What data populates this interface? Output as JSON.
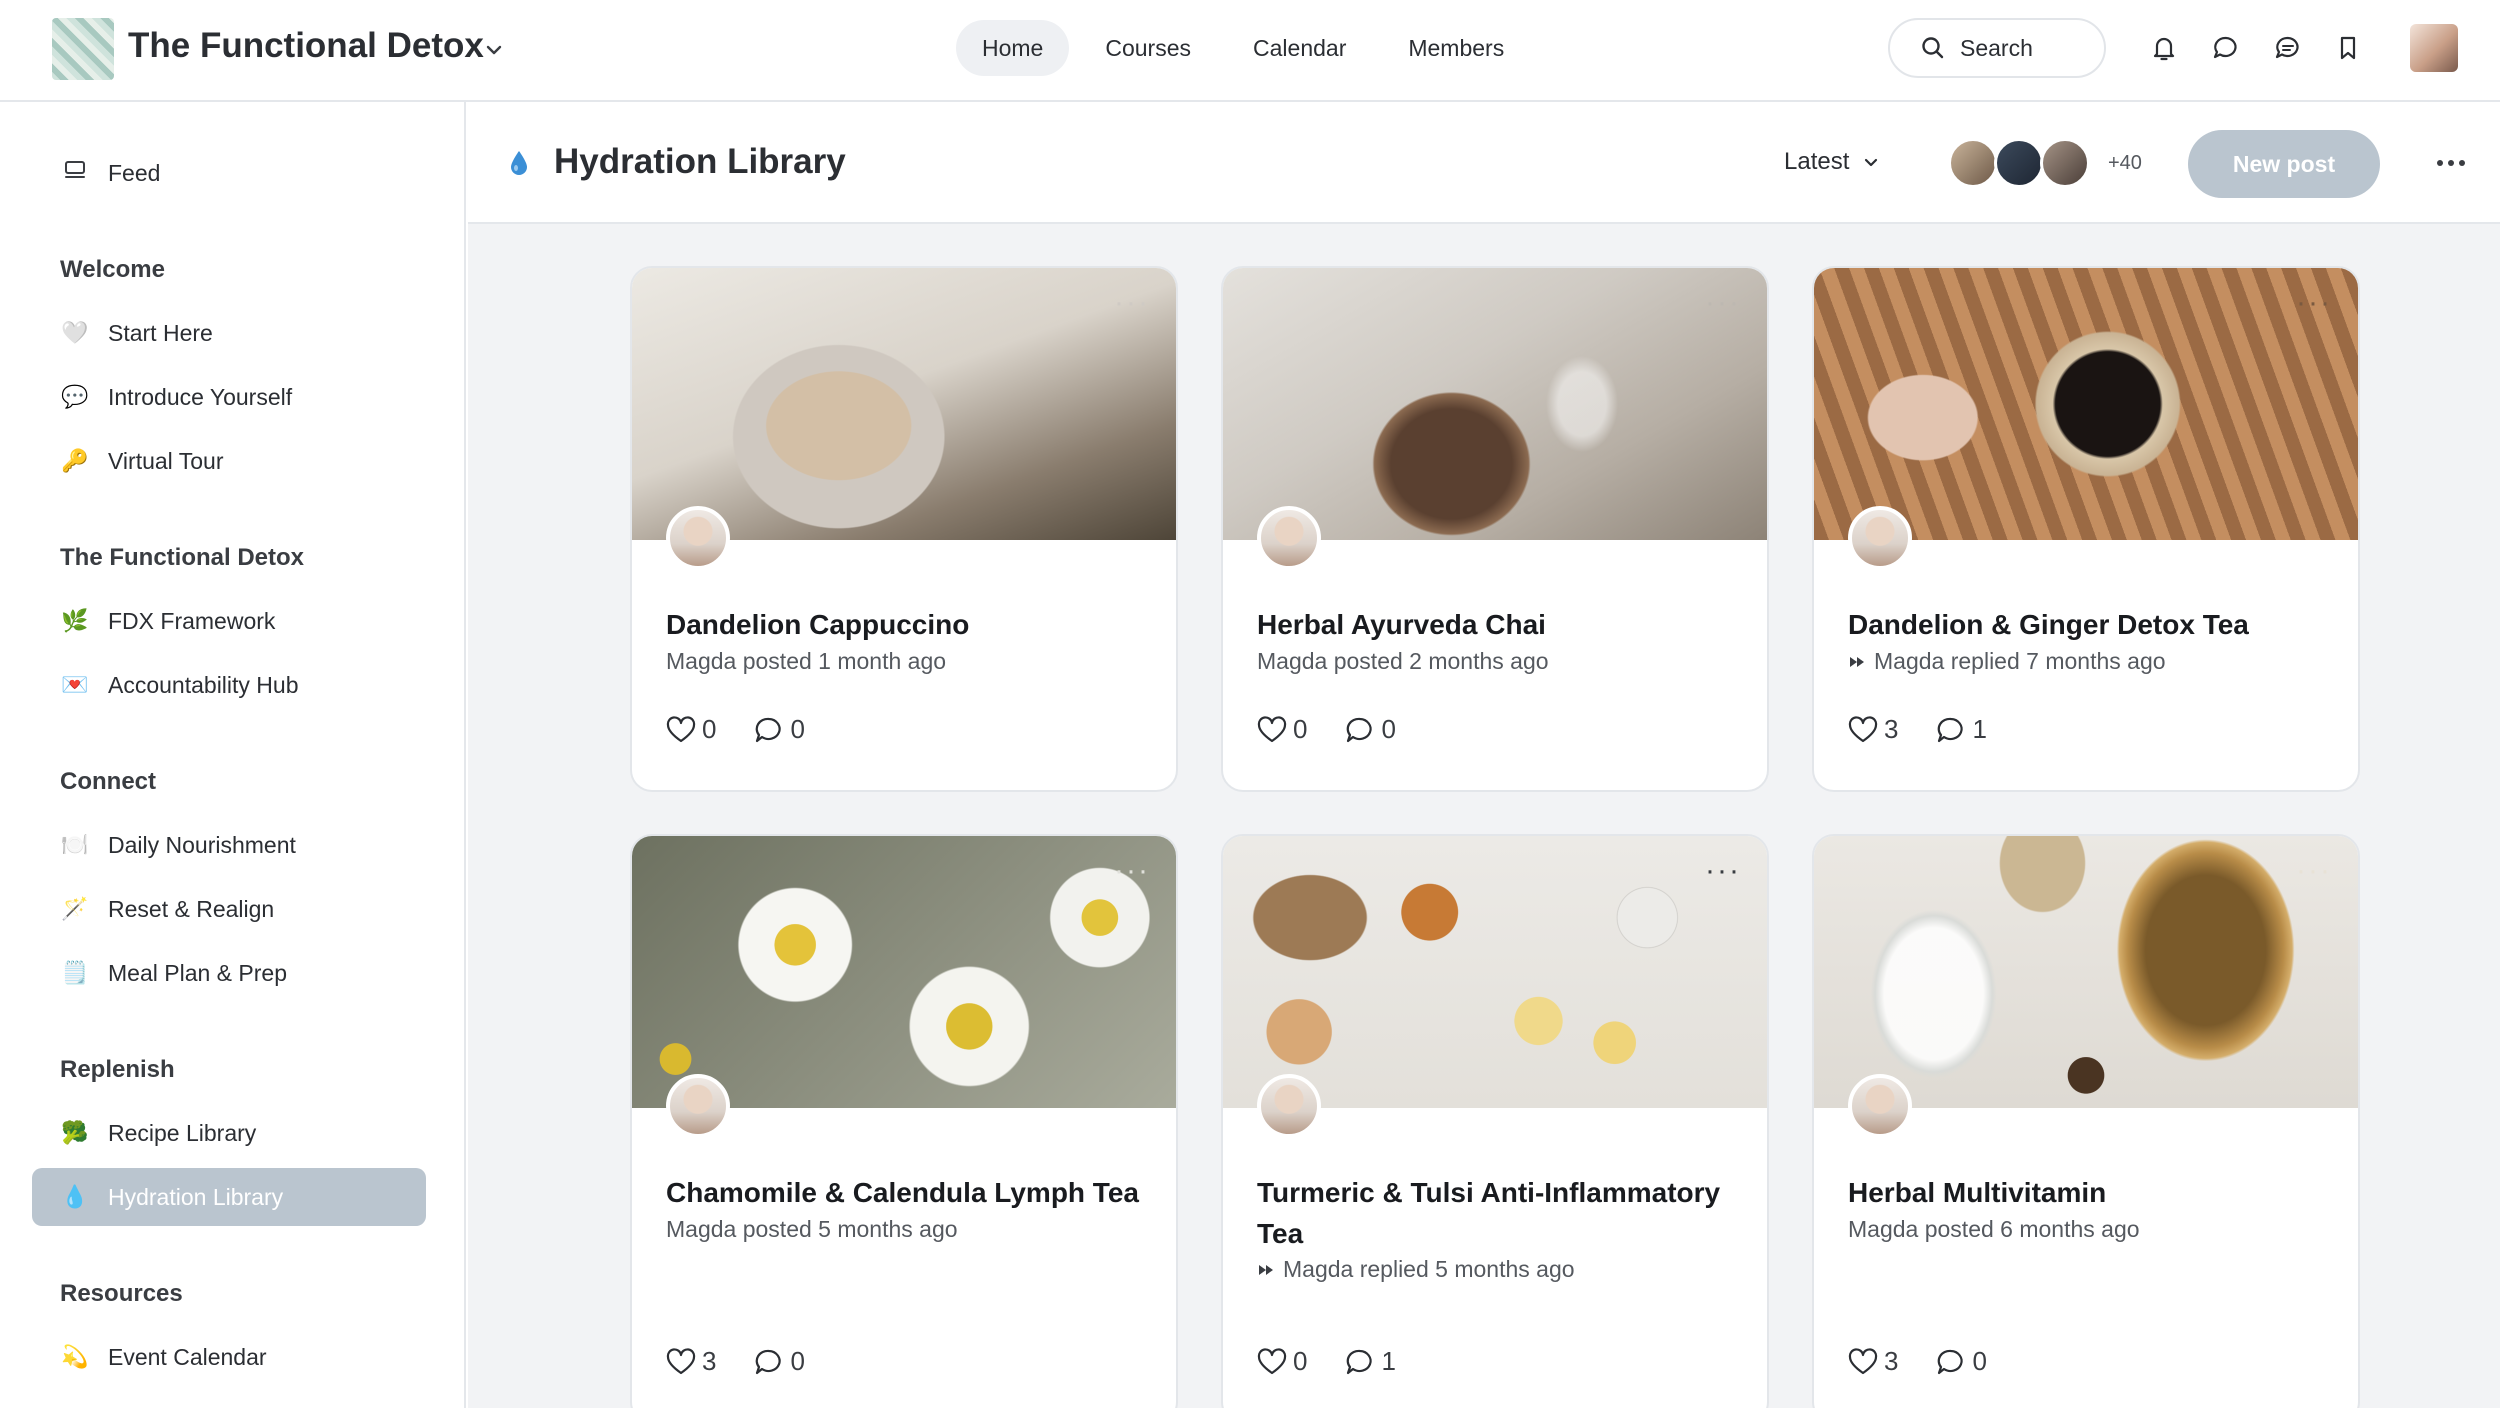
{
  "topbar": {
    "community_name": "The Functional Detox",
    "nav": [
      "Home",
      "Courses",
      "Calendar",
      "Members"
    ],
    "active_nav": "Home",
    "search_label": "Search",
    "icons": [
      "bell-icon",
      "chat-bubble-icon",
      "messages-icon",
      "bookmark-icon"
    ]
  },
  "sidebar": {
    "feed": {
      "emoji": "",
      "label": "Feed"
    },
    "sections": [
      {
        "heading": "Welcome",
        "items": [
          {
            "emoji": "🤍",
            "label": "Start Here"
          },
          {
            "emoji": "💬",
            "label": "Introduce Yourself"
          },
          {
            "emoji": "🔑",
            "label": "Virtual Tour"
          }
        ]
      },
      {
        "heading": "The Functional Detox",
        "items": [
          {
            "emoji": "🌿",
            "label": "FDX Framework"
          },
          {
            "emoji": "💌",
            "label": "Accountability Hub"
          }
        ]
      },
      {
        "heading": "Connect",
        "items": [
          {
            "emoji": "🍽️",
            "label": "Daily Nourishment"
          },
          {
            "emoji": "🪄",
            "label": "Reset & Realign"
          },
          {
            "emoji": "🗒️",
            "label": "Meal Plan & Prep"
          }
        ]
      },
      {
        "heading": "Replenish",
        "items": [
          {
            "emoji": "🥦",
            "label": "Recipe Library"
          },
          {
            "emoji": "💧",
            "label": "Hydration Library"
          }
        ]
      },
      {
        "heading": "Resources",
        "items": [
          {
            "emoji": "💫",
            "label": "Event Calendar"
          }
        ]
      }
    ],
    "active_item": "Hydration Library"
  },
  "main": {
    "title": "Hydration Library",
    "sort_label": "Latest",
    "members_more": "+40",
    "new_post_label": "New post"
  },
  "posts": [
    {
      "title": "Dandelion Cappuccino",
      "meta": "Magda posted 1 month ago",
      "replied": false,
      "likes": "0",
      "comments": "0"
    },
    {
      "title": "Herbal Ayurveda Chai",
      "meta": "Magda posted 2 months ago",
      "replied": false,
      "likes": "0",
      "comments": "0"
    },
    {
      "title": "Dandelion & Ginger Detox Tea",
      "meta": "Magda replied 7 months ago",
      "replied": true,
      "likes": "3",
      "comments": "1"
    },
    {
      "title": "Chamomile & Calendula Lymph Tea",
      "meta": "Magda posted 5 months ago",
      "replied": false,
      "likes": "3",
      "comments": "0"
    },
    {
      "title": "Turmeric & Tulsi Anti-Inflammatory Tea",
      "meta": "Magda replied 5 months ago",
      "replied": true,
      "likes": "0",
      "comments": "1"
    },
    {
      "title": "Herbal Multivitamin",
      "meta": "Magda posted 6 months ago",
      "replied": false,
      "likes": "3",
      "comments": "0"
    }
  ],
  "colors": {
    "active_sidebar": "#bac5cf",
    "new_post_button": "#bac5cf",
    "content_background": "#f2f3f5",
    "drop_icon": "#3b8fd6"
  }
}
